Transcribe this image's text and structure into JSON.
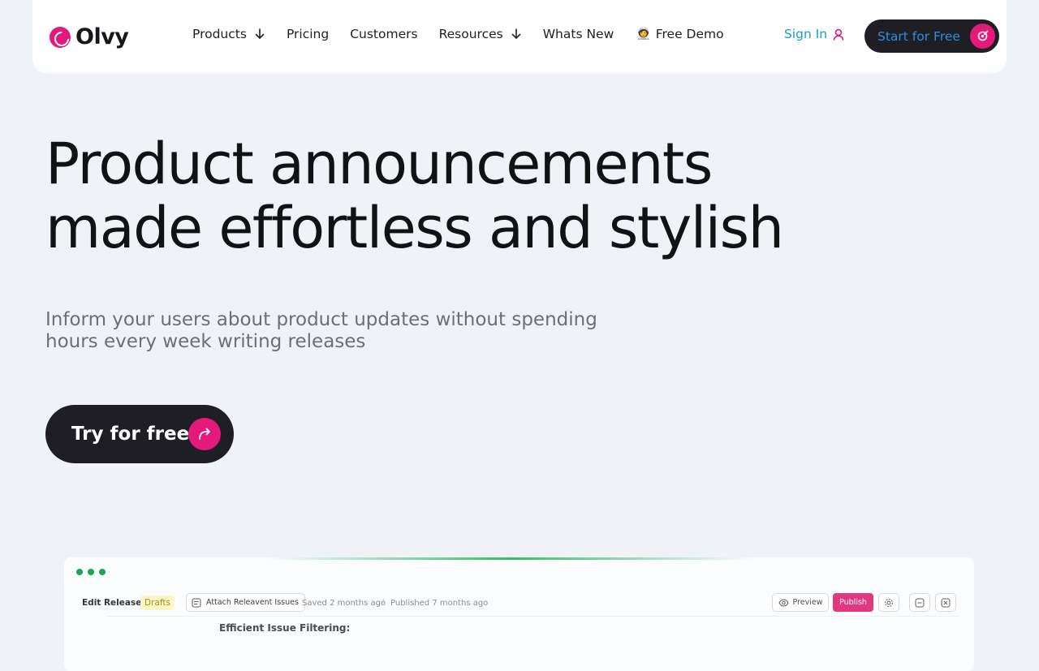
{
  "brand": {
    "name": "Olvy",
    "accent": "#e3197b",
    "dark": "#1e1e24",
    "link": "#1b98e0"
  },
  "nav": {
    "items": [
      {
        "label": "Products",
        "has_dropdown": true
      },
      {
        "label": "Pricing",
        "has_dropdown": false
      },
      {
        "label": "Customers",
        "has_dropdown": false
      },
      {
        "label": "Resources",
        "has_dropdown": true
      },
      {
        "label": "Whats New",
        "has_dropdown": false
      },
      {
        "label": "Free Demo",
        "emoji": "🧑‍🚀",
        "has_dropdown": false
      }
    ],
    "sign_in": "Sign In",
    "start_free": "Start for Free"
  },
  "hero": {
    "title_line1": "Product announcements",
    "title_line2": "made effortless and stylish",
    "subtitle_line1": "Inform your users about product updates without spending",
    "subtitle_line2": "hours every week writing releases",
    "cta": "Try for free"
  },
  "editor": {
    "title": "Edit Release",
    "status_badge": "Drafts",
    "attach_button": "Attach Releavent Issues",
    "saved": "Saved 2 months ago",
    "separator": "/",
    "published": "Published 7 months ago",
    "preview_button": "Preview",
    "publish_button": "Publish",
    "content_heading": "Efficient Issue Filtering:"
  }
}
